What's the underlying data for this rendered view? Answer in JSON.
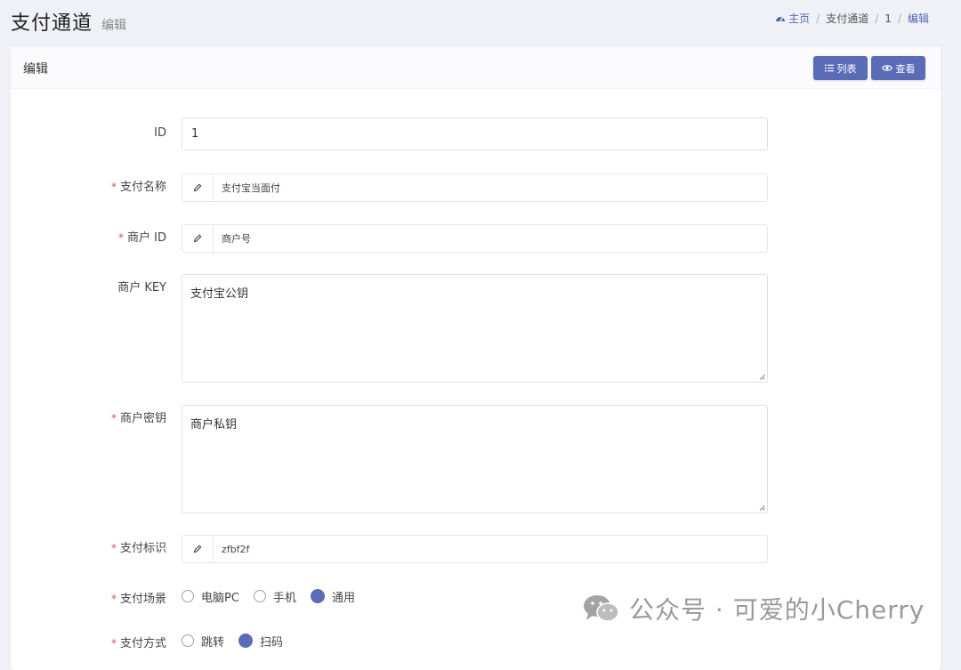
{
  "header": {
    "title": "支付通道",
    "subtitle": "编辑"
  },
  "breadcrumb": {
    "home": "主页",
    "items": [
      "支付通道",
      "1"
    ],
    "active": "编辑"
  },
  "card": {
    "title": "编辑",
    "buttons": {
      "list": "列表",
      "view": "查看"
    }
  },
  "form": {
    "id": {
      "label": "ID",
      "value": "1"
    },
    "name": {
      "label": "支付名称",
      "value": "支付宝当面付"
    },
    "merchant_id": {
      "label": "商户 ID",
      "value": "商户号"
    },
    "merchant_key": {
      "label": "商户 KEY",
      "value": "支付宝公钥"
    },
    "merchant_secret": {
      "label": "商户密钥",
      "value": "商户私钥"
    },
    "pay_flag": {
      "label": "支付标识",
      "value": "zfbf2f"
    },
    "scene": {
      "label": "支付场景",
      "options": [
        "电脑PC",
        "手机",
        "通用"
      ],
      "selected": "通用"
    },
    "method": {
      "label": "支付方式",
      "options": [
        "跳转",
        "扫码"
      ],
      "selected": "扫码"
    }
  },
  "watermark": {
    "text": "公众号 · 可爱的小Cherry"
  },
  "colors": {
    "accent": "#5a6bb8",
    "required": "#d9534f",
    "background": "#f0f1f6"
  }
}
